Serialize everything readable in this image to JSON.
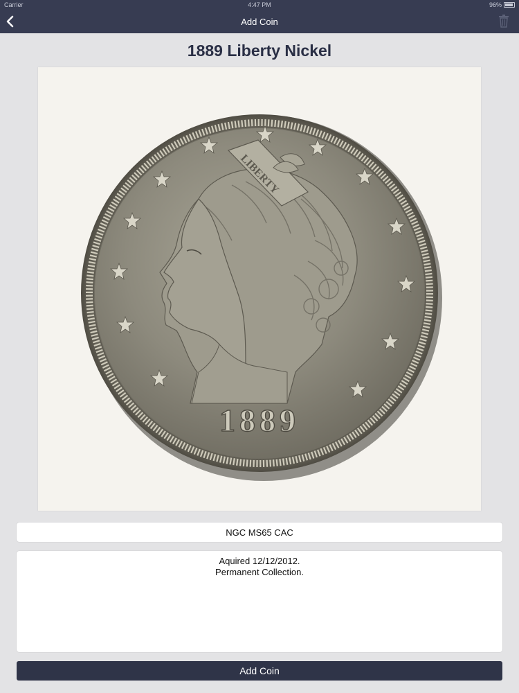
{
  "status_bar": {
    "carrier": "Carrier",
    "time": "4:47 PM",
    "battery": "96%"
  },
  "nav": {
    "title": "Add Coin",
    "back_icon": "chevron-left-icon",
    "trash_icon": "trash-icon"
  },
  "coin": {
    "title": "1889 Liberty Nickel",
    "image_icon": "liberty-nickel-coin-image",
    "year_on_coin": "1889",
    "legend_on_coin": "LIBERTY"
  },
  "grade": {
    "value": "NGC MS65 CAC"
  },
  "notes": {
    "lines": [
      "Aquired 12/12/2012.",
      "Permanent Collection."
    ]
  },
  "actions": {
    "add_label": "Add Coin"
  },
  "colors": {
    "nav_bg": "#373c52",
    "page_bg": "#e3e3e5",
    "button_bg": "#2f3448",
    "title_text": "#2a2f45"
  }
}
